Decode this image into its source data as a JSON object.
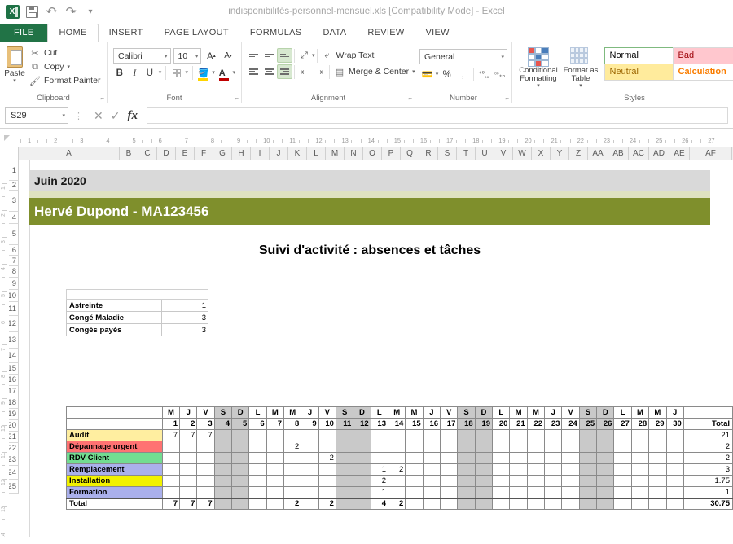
{
  "window": {
    "title": "indisponibilités-personnel-mensuel.xls  [Compatibility Mode] - Excel",
    "qat": [
      {
        "name": "excel-logo-icon",
        "label": "X"
      },
      {
        "name": "save-icon",
        "label": ""
      },
      {
        "name": "undo-icon",
        "label": "↶"
      },
      {
        "name": "redo-icon",
        "label": "↷"
      },
      {
        "name": "customize-qat-icon",
        "label": "▾"
      }
    ]
  },
  "ribbon": {
    "tabs": [
      {
        "label": "FILE",
        "active": false,
        "file": true
      },
      {
        "label": "HOME",
        "active": true
      },
      {
        "label": "INSERT",
        "active": false
      },
      {
        "label": "PAGE LAYOUT",
        "active": false
      },
      {
        "label": "FORMULAS",
        "active": false
      },
      {
        "label": "DATA",
        "active": false
      },
      {
        "label": "REVIEW",
        "active": false
      },
      {
        "label": "VIEW",
        "active": false
      }
    ],
    "clipboard": {
      "group_label": "Clipboard",
      "paste": "Paste",
      "cut": "Cut",
      "copy": "Copy",
      "format_painter": "Format Painter"
    },
    "font": {
      "group_label": "Font",
      "family": "Calibri",
      "size": "10",
      "grow": "A",
      "shrink": "A",
      "bold": "B",
      "italic": "I",
      "underline": "U"
    },
    "alignment": {
      "group_label": "Alignment",
      "wrap_text": "Wrap Text",
      "merge_center": "Merge & Center"
    },
    "number": {
      "group_label": "Number",
      "format": "General",
      "percent": "%",
      "comma": ","
    },
    "styles": {
      "group_label": "Styles",
      "conditional_formatting": "Conditional Formatting",
      "format_as_table": "Format as Table",
      "gallery": [
        {
          "label": "Normal",
          "cls": "normal"
        },
        {
          "label": "Bad",
          "cls": "bad"
        },
        {
          "label": "Neutral",
          "cls": "neutral"
        },
        {
          "label": "Calculation",
          "cls": "calc"
        }
      ]
    }
  },
  "formula_bar": {
    "name_box": "S29",
    "cancel_icon": "✕",
    "enter_icon": "✓",
    "fx_icon": "fx",
    "value": ""
  },
  "sheet": {
    "columns": [
      "A",
      "B",
      "C",
      "D",
      "E",
      "F",
      "G",
      "H",
      "I",
      "J",
      "K",
      "L",
      "M",
      "N",
      "O",
      "P",
      "Q",
      "R",
      "S",
      "T",
      "U",
      "V",
      "W",
      "X",
      "Y",
      "Z",
      "AA",
      "AB",
      "AC",
      "AD",
      "AE",
      "AF",
      "A"
    ],
    "rows": [
      "1",
      "2",
      "3",
      "4",
      "5",
      "6",
      "7",
      "8",
      "9",
      "10",
      "11",
      "12",
      "13",
      "14",
      "15",
      "16",
      "17",
      "18",
      "19",
      "20",
      "21",
      "22",
      "23",
      "24",
      "25"
    ],
    "ruler_h": [
      "1",
      "2",
      "3",
      "4",
      "5",
      "6",
      "7",
      "8",
      "9",
      "10",
      "11",
      "12",
      "13",
      "14",
      "15",
      "16",
      "17",
      "18",
      "19",
      "20",
      "21",
      "22",
      "23",
      "24",
      "25",
      "26",
      "27"
    ],
    "ruler_v": [
      "1",
      "2",
      "3",
      "4",
      "5",
      "6",
      "7",
      "8",
      "9",
      "10",
      "11",
      "12",
      "13",
      "14"
    ]
  },
  "content": {
    "month": "Juin 2020",
    "employee": "Hervé Dupond -  MA123456",
    "main_title": "Suivi d'activité : absences et tâches",
    "absences": [
      {
        "label": "Astreinte",
        "value": "1"
      },
      {
        "label": "Congé Maladie",
        "value": "3"
      },
      {
        "label": "Congés payés",
        "value": "3"
      }
    ],
    "total_label": "Total"
  },
  "chart_data": {
    "type": "table",
    "title": "Suivi d'activité : absences et tâches",
    "day_letters": [
      "M",
      "J",
      "V",
      "S",
      "D",
      "L",
      "M",
      "M",
      "J",
      "V",
      "S",
      "D",
      "L",
      "M",
      "M",
      "J",
      "V",
      "S",
      "D",
      "L",
      "M",
      "M",
      "J",
      "V",
      "S",
      "D",
      "L",
      "M",
      "M",
      "J"
    ],
    "day_numbers": [
      "1",
      "2",
      "3",
      "4",
      "5",
      "6",
      "7",
      "8",
      "9",
      "10",
      "11",
      "12",
      "13",
      "14",
      "15",
      "16",
      "17",
      "18",
      "19",
      "20",
      "21",
      "22",
      "23",
      "24",
      "25",
      "26",
      "27",
      "28",
      "29",
      "30"
    ],
    "weekend_days": [
      4,
      5,
      11,
      12,
      18,
      19,
      25,
      26
    ],
    "total_header": "Total",
    "rows": [
      {
        "label": "Audit",
        "color": "#ffeea0",
        "values": [
          "7",
          "7",
          "7",
          "",
          "",
          "",
          "",
          "",
          "",
          "",
          "",
          "",
          "",
          "",
          "",
          "",
          "",
          "",
          "",
          "",
          "",
          "",
          "",
          "",
          "",
          "",
          "",
          "",
          "",
          ""
        ],
        "total": "21"
      },
      {
        "label": "Dépannage urgent",
        "color": "#ff7272",
        "values": [
          "",
          "",
          "",
          "",
          "",
          "",
          "",
          "2",
          "",
          "",
          "",
          "",
          "",
          "",
          "",
          "",
          "",
          "",
          "",
          "",
          "",
          "",
          "",
          "",
          "",
          "",
          "",
          "",
          "",
          ""
        ],
        "total": "2"
      },
      {
        "label": "RDV Client",
        "color": "#72dd91",
        "values": [
          "",
          "",
          "",
          "",
          "",
          "",
          "",
          "",
          "",
          "2",
          "",
          "",
          "",
          "",
          "",
          "",
          "",
          "",
          "",
          "",
          "",
          "",
          "",
          "",
          "",
          "",
          "",
          "",
          "",
          ""
        ],
        "total": "2"
      },
      {
        "label": "Remplacement",
        "color": "#aab0ec",
        "values": [
          "",
          "",
          "",
          "",
          "",
          "",
          "",
          "",
          "",
          "",
          "",
          "",
          "1",
          "2",
          "",
          "",
          "",
          "",
          "",
          "",
          "",
          "",
          "",
          "",
          "",
          "",
          "",
          "",
          "",
          ""
        ],
        "total": "3"
      },
      {
        "label": "Installation",
        "color": "#f2f200",
        "values": [
          "",
          "",
          "",
          "",
          "",
          "",
          "",
          "",
          "",
          "",
          "",
          "",
          "2",
          "",
          "",
          "",
          "",
          "",
          "",
          "",
          "",
          "",
          "",
          "",
          "",
          "",
          "",
          "",
          "",
          ""
        ],
        "total": "1.75"
      },
      {
        "label": "Formation",
        "color": "#aab0ec",
        "values": [
          "",
          "",
          "",
          "",
          "",
          "",
          "",
          "",
          "",
          "",
          "",
          "",
          "1",
          "",
          "",
          "",
          "",
          "",
          "",
          "",
          "",
          "",
          "",
          "",
          "",
          "",
          "",
          "",
          "",
          ""
        ],
        "total": "1"
      }
    ],
    "totals_row": {
      "label": "Total",
      "values": [
        "7",
        "7",
        "7",
        "",
        "",
        "",
        "",
        "2",
        "",
        "2",
        "",
        "",
        "4",
        "2",
        "",
        "",
        "",
        "",
        "",
        "",
        "",
        "",
        "",
        "",
        "",
        "",
        "",
        "",
        "",
        ""
      ],
      "total": "30.75"
    }
  }
}
